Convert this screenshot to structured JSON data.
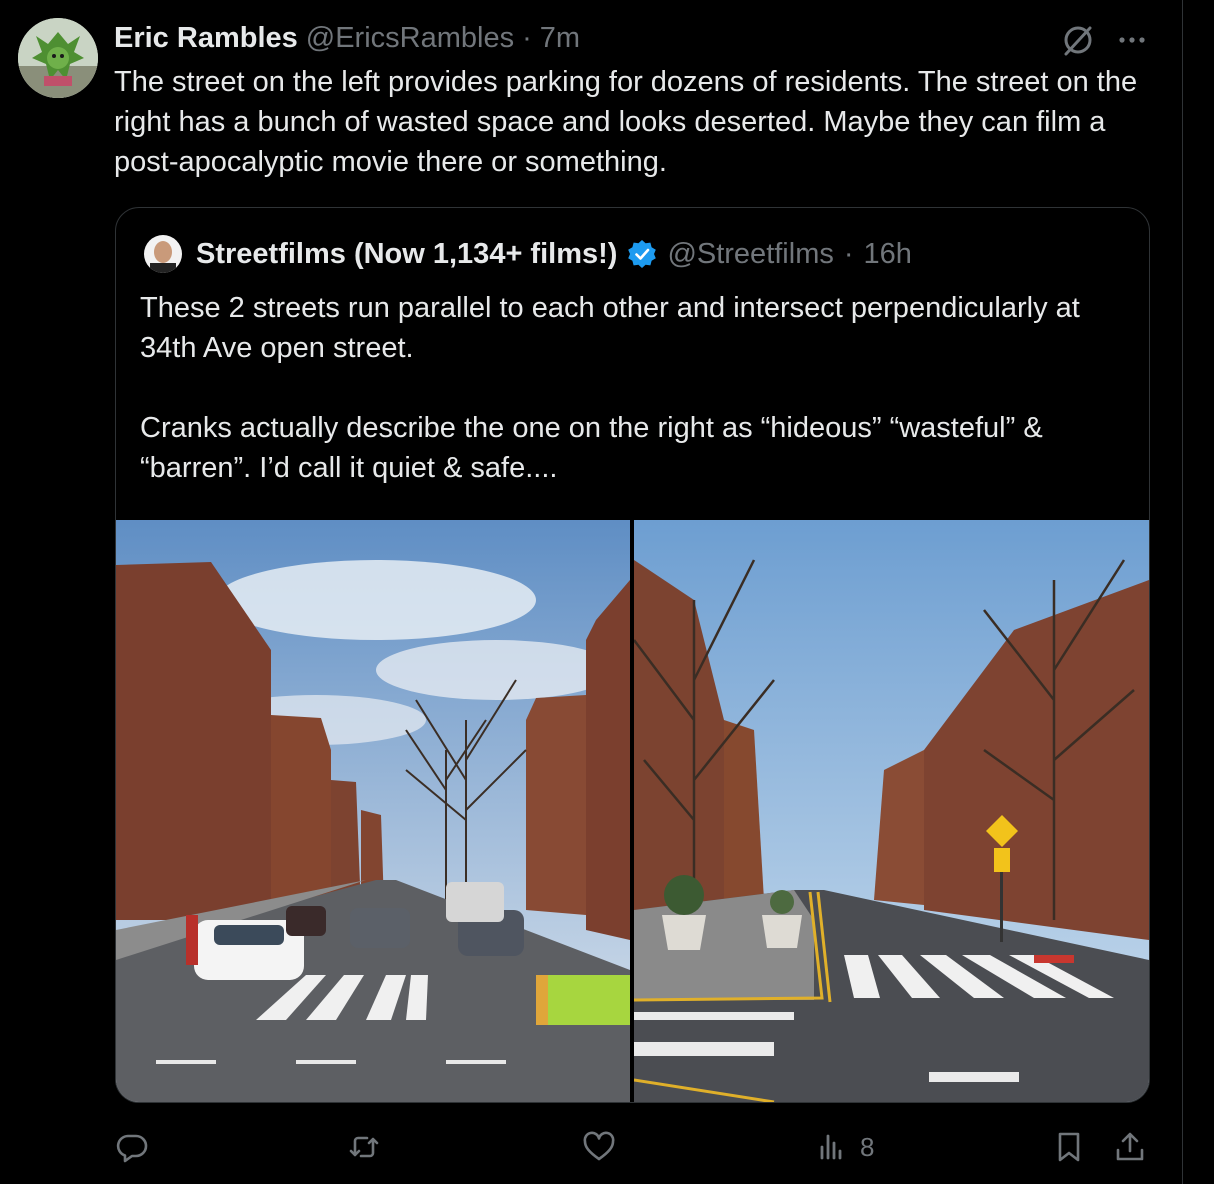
{
  "post": {
    "author_name": "Eric Rambles",
    "author_handle": "@EricsRambles",
    "separator": "·",
    "time": "7m",
    "text": "The street on the left provides parking for dozens of residents. The street on the right has a bunch of wasted space and looks deserted. Maybe they can film a post-apocalyptic movie there or something.",
    "header_icons": [
      "grok-icon",
      "more-icon"
    ]
  },
  "quote": {
    "author_name": "Streetfilms (Now 1,134+ films!)",
    "author_handle": "@Streetfilms",
    "separator": "·",
    "time": "16h",
    "verified": true,
    "paragraph_1": "These 2 streets run parallel to each other and intersect perpendicularly at 34th Ave open street.",
    "paragraph_2": "Cranks actually describe the one on the right as “hideous” “wasteful” & “barren”. I’d call it quiet & safe....",
    "images": [
      "street-with-parked-cars-photo",
      "open-street-with-planters-photo"
    ]
  },
  "actions": {
    "reply_count": "",
    "repost_count": "",
    "like_count": "",
    "views_count": "8",
    "icons": [
      "reply-icon",
      "repost-icon",
      "like-icon",
      "views-icon",
      "bookmark-icon",
      "share-icon"
    ]
  },
  "colors": {
    "background": "#000000",
    "text": "#e7e9ea",
    "secondary_text": "#71767b",
    "border": "#2f3336",
    "verified": "#1d9bf0"
  }
}
